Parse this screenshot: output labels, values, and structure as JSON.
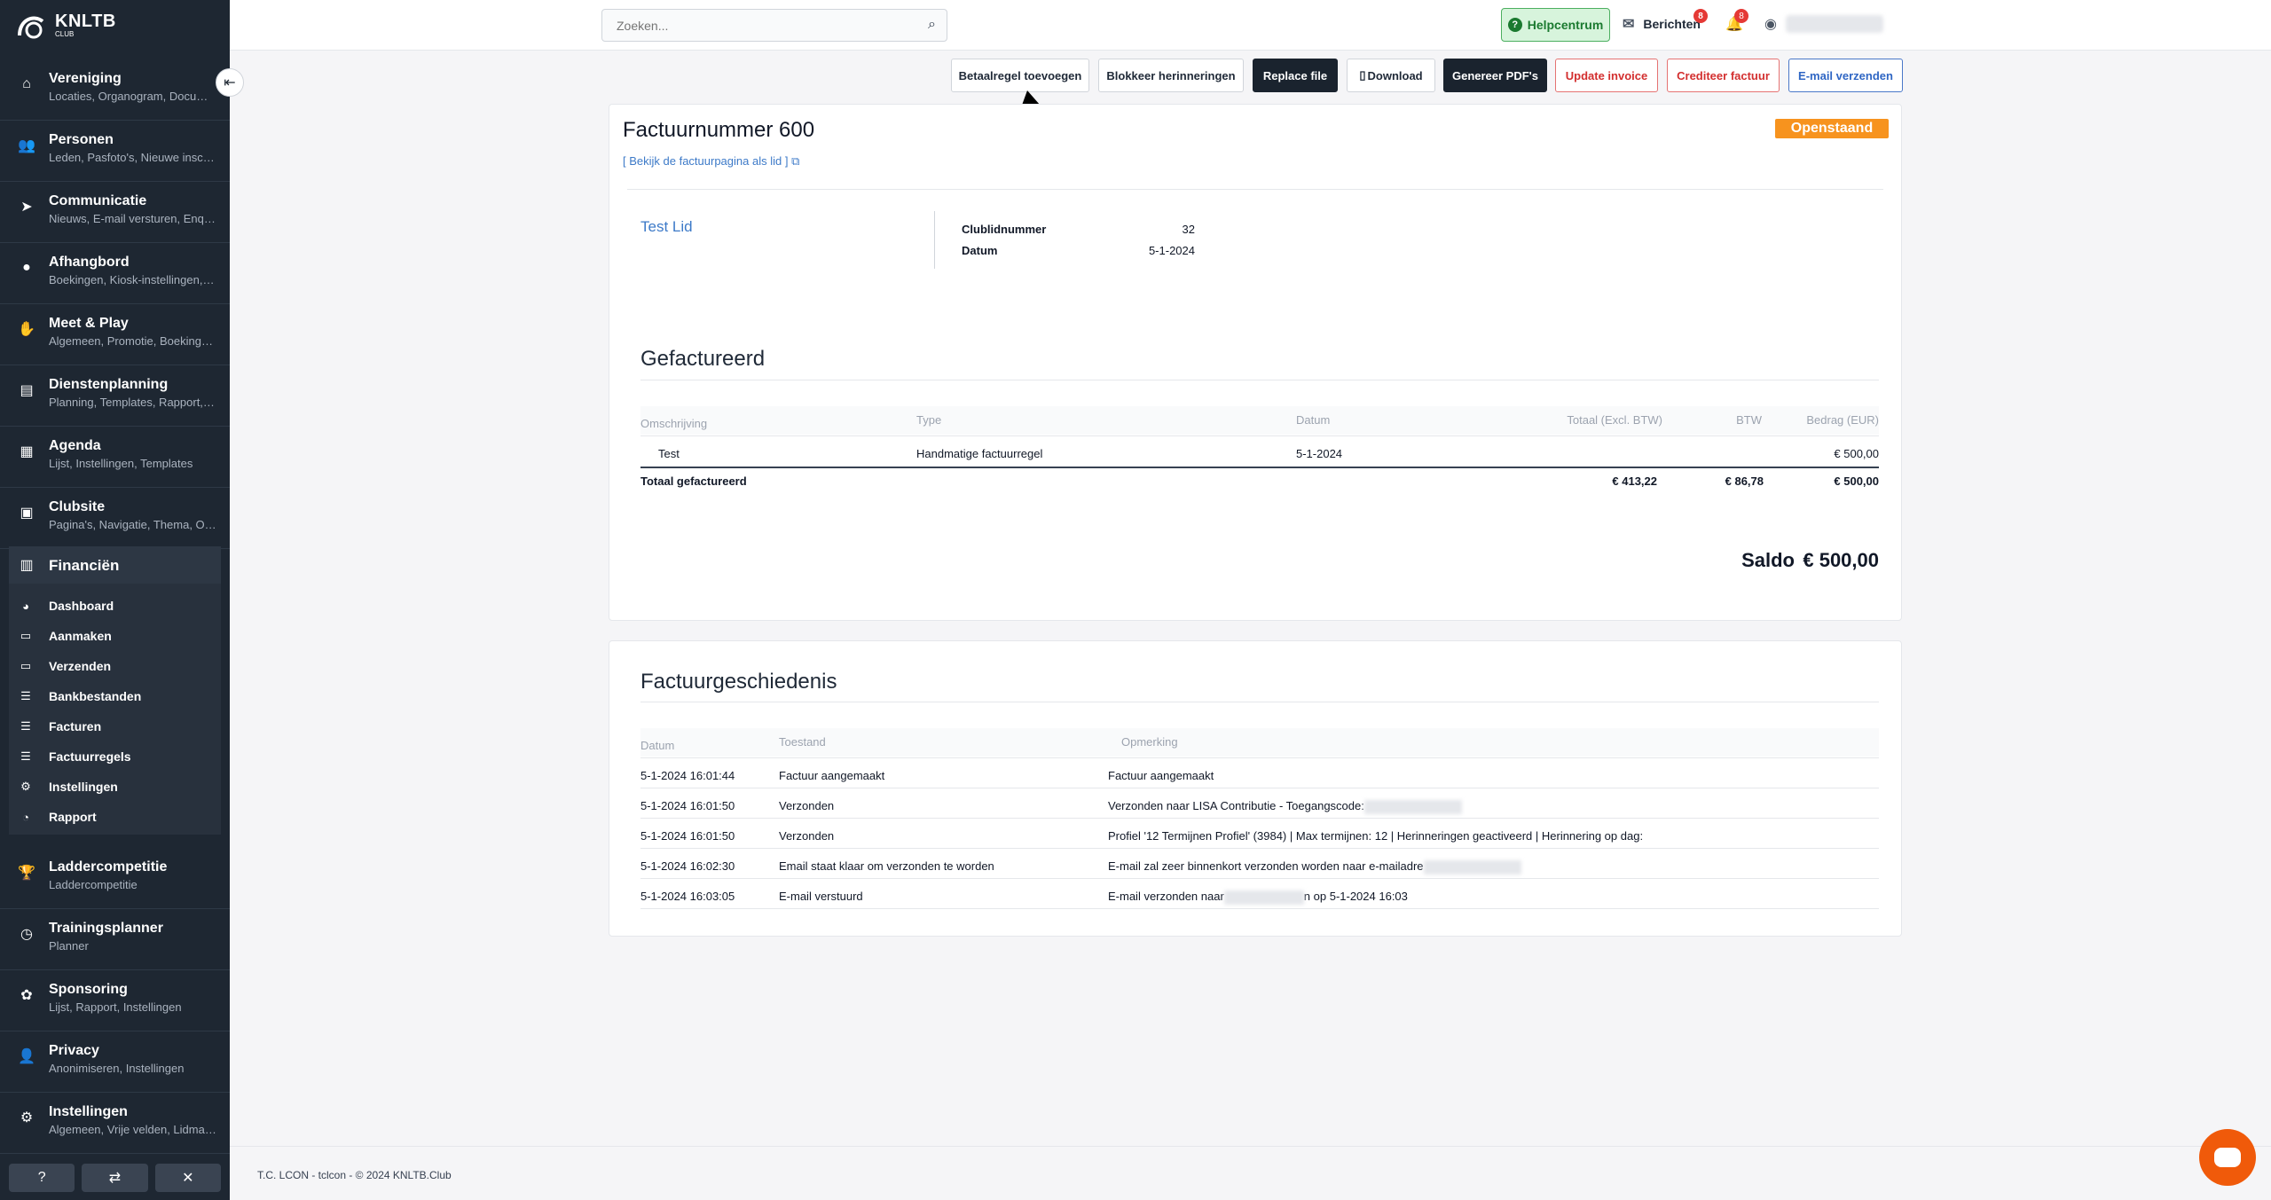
{
  "sidebar": {
    "logo": "KNLTB",
    "logo_sub": "CLUB",
    "collapse_icon": "collapse-left-icon",
    "groups": [
      {
        "title": "Vereniging",
        "sub": "Locaties, Organogram, Documenten",
        "icon": "home-icon"
      },
      {
        "title": "Personen",
        "sub": "Leden, Pasfoto's, Nieuwe inschrijvingen",
        "icon": "people-icon"
      },
      {
        "title": "Communicatie",
        "sub": "Nieuws, E-mail versturen, Enquêtes",
        "icon": "paper-plane-icon"
      },
      {
        "title": "Afhangbord",
        "sub": "Boekingen, Kiosk-instellingen, Banen",
        "icon": "ball-icon"
      },
      {
        "title": "Meet & Play",
        "sub": "Algemeen, Promotie, Boekingsinstellingen",
        "icon": "handshake-icon"
      },
      {
        "title": "Dienstenplanning",
        "sub": "Planning, Templates, Rapport, Instellingen",
        "icon": "clipboard-icon"
      },
      {
        "title": "Agenda",
        "sub": "Lijst, Instellingen, Templates",
        "icon": "calendar-icon"
      },
      {
        "title": "Clubsite",
        "sub": "Pagina's, Navigatie, Thema, Opties",
        "icon": "browser-icon"
      }
    ],
    "finance": {
      "title": "Financiën",
      "icon": "receipt-icon",
      "items": [
        {
          "label": "Dashboard",
          "icon": "gauge-icon"
        },
        {
          "label": "Aanmaken",
          "icon": "card-icon"
        },
        {
          "label": "Verzenden",
          "icon": "card-icon"
        },
        {
          "label": "Bankbestanden",
          "icon": "list-icon"
        },
        {
          "label": "Facturen",
          "icon": "list-icon"
        },
        {
          "label": "Factuurregels",
          "icon": "list-icon"
        },
        {
          "label": "Instellingen",
          "icon": "gears-icon"
        },
        {
          "label": "Rapport",
          "icon": "pie-chart-icon"
        }
      ]
    },
    "groups_after": [
      {
        "title": "Laddercompetitie",
        "sub": "Laddercompetitie",
        "icon": "trophy-icon"
      },
      {
        "title": "Trainingsplanner",
        "sub": "Planner",
        "icon": "clock-icon"
      },
      {
        "title": "Sponsoring",
        "sub": "Lijst, Rapport, Instellingen",
        "icon": "ribbon-icon"
      },
      {
        "title": "Privacy",
        "sub": "Anonimiseren, Instellingen",
        "icon": "user-lock-icon"
      },
      {
        "title": "Instellingen",
        "sub": "Algemeen, Vrije velden, Lidmaatschappen",
        "icon": "gears-icon"
      }
    ],
    "bottom": [
      "help-icon",
      "switch-icon",
      "tools-icon"
    ]
  },
  "topbar": {
    "search_placeholder": "Zoeken...",
    "help_label": "Helpcentrum",
    "messages_label": "Berichten",
    "messages_count": "8",
    "notifications_count": "8"
  },
  "actions": {
    "add_payment": "Betaalregel toevoegen",
    "block_reminders": "Blokkeer herinneringen",
    "replace_file": "Replace file",
    "download": "Download",
    "generate_pdf": "Genereer PDF's",
    "update_invoice": "Update invoice",
    "credit_invoice": "Crediteer factuur",
    "send_email": "E-mail verzenden"
  },
  "invoice": {
    "title": "Factuurnummer 600",
    "member_link": "[ Bekijk de factuurpagina als lid ]",
    "status": "Openstaand",
    "member_name": "Test Lid",
    "club_number_label": "Clublidnummer",
    "club_number": "32",
    "date_label": "Datum",
    "date": "5-1-2024",
    "billed_title": "Gefactureerd",
    "columns": {
      "description": "Omschrijving",
      "type": "Type",
      "date": "Datum",
      "total_excl": "Totaal (Excl. BTW)",
      "vat": "BTW",
      "amount": "Bedrag (EUR)"
    },
    "rows": [
      {
        "description": "Test",
        "type": "Handmatige factuurregel",
        "date": "5-1-2024",
        "amount": "€ 500,00"
      }
    ],
    "total": {
      "label": "Totaal gefactureerd",
      "excl": "€ 413,22",
      "vat": "€ 86,78",
      "amount": "€ 500,00"
    },
    "saldo_label": "Saldo",
    "saldo_value": "€ 500,00"
  },
  "history": {
    "title": "Factuurgeschiedenis",
    "columns": {
      "date": "Datum",
      "state": "Toestand",
      "remark": "Opmerking"
    },
    "rows": [
      {
        "date": "5-1-2024 16:01:44",
        "state": "Factuur aangemaakt",
        "remark": "Factuur aangemaakt"
      },
      {
        "date": "5-1-2024 16:01:50",
        "state": "Verzonden",
        "remark": "Verzonden naar LISA Contributie - Toegangscode:"
      },
      {
        "date": "5-1-2024 16:01:50",
        "state": "Verzonden",
        "remark": "Profiel '12 Termijnen Profiel' (3984) | Max termijnen: 12 | Herinneringen geactiveerd | Herinnering op dag:"
      },
      {
        "date": "5-1-2024 16:02:30",
        "state": "Email staat klaar om verzonden te worden",
        "remark": "E-mail zal zeer binnenkort verzonden worden naar e-mailadre"
      },
      {
        "date": "5-1-2024 16:03:05",
        "state": "E-mail verstuurd",
        "remark_pre": "E-mail verzonden naar",
        "remark_post": "n op 5-1-2024 16:03"
      }
    ]
  },
  "footer": {
    "text": "T.C. LCON - tclcon - © 2024 KNLTB.Club"
  },
  "colors": {
    "sidebar": "#1e2732",
    "status": "#f7931e",
    "link": "#3d7ac8",
    "chat": "#f05a0a"
  }
}
